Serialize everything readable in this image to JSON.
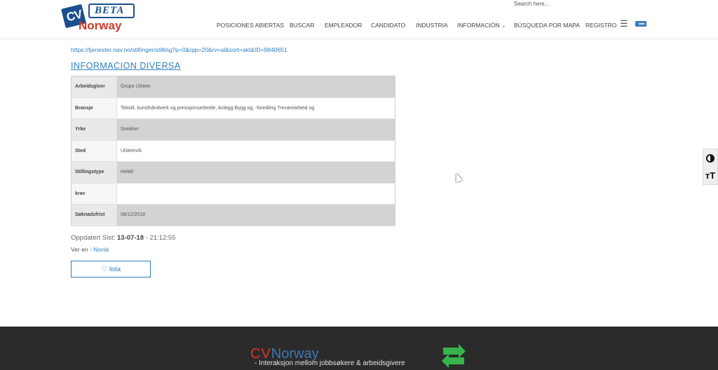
{
  "header": {
    "logo": {
      "cv": "CV",
      "beta": "BETA",
      "norway": "Norway"
    },
    "search_placeholder": "Search here...",
    "nav": [
      {
        "label": "POSICIONES ABIERTAS"
      },
      {
        "label": "BUSCAR"
      },
      {
        "label": "EMPLEADOR"
      },
      {
        "label": "CANDIDATO"
      },
      {
        "label": "INDUSTRIA"
      },
      {
        "label": "INFORMACIÓN"
      },
      {
        "label": "BÚSQUEDA POR MAPA"
      },
      {
        "label": "REGISTRO"
      }
    ],
    "menu_icon": "hamburger-icon",
    "flag_icon": "language-flag-icon"
  },
  "content": {
    "url": "https://tjenester.nav.no/stillinger/stilling?p=0&rpp=20&rv=al&sort=akt&ID=9840651",
    "section_title": "INFORMACION DIVERSA",
    "rows": [
      {
        "label": "Arbeidsgiver",
        "value": "Grupo Ulstein"
      },
      {
        "label": "Bransje",
        "value": "Tekstil, kunsthåndverk og presisjonsarbeide, Anlegg Bygg og, -foredling Trevarearbeid og"
      },
      {
        "label": "Yrke",
        "value": "Snekker"
      },
      {
        "label": "Sted",
        "value": "Ulsteinvik"
      },
      {
        "label": "Stillingstype",
        "value": "Heltid"
      },
      {
        "label": "krav",
        "value": ""
      },
      {
        "label": "Søknadsfrist",
        "value": "08/12/2018"
      }
    ],
    "updated": {
      "prefix": "Oppdatert Sist: ",
      "date": "13-07-18",
      "separator": " - ",
      "time": "21:12:55"
    },
    "lang": {
      "prefix": "Ver en - ",
      "link": "Norsk"
    },
    "lista_button": "lista"
  },
  "toolbar": {
    "contrast_icon": "contrast-icon",
    "text_size_icon": "text-size-icon",
    "text_size_glyph": "тT"
  },
  "footer": {
    "logo_cv": "CV",
    "logo_norway": "Norway",
    "tagline": "- Interaksjon mellom  jobbsøkere & arbeidsgivere"
  }
}
